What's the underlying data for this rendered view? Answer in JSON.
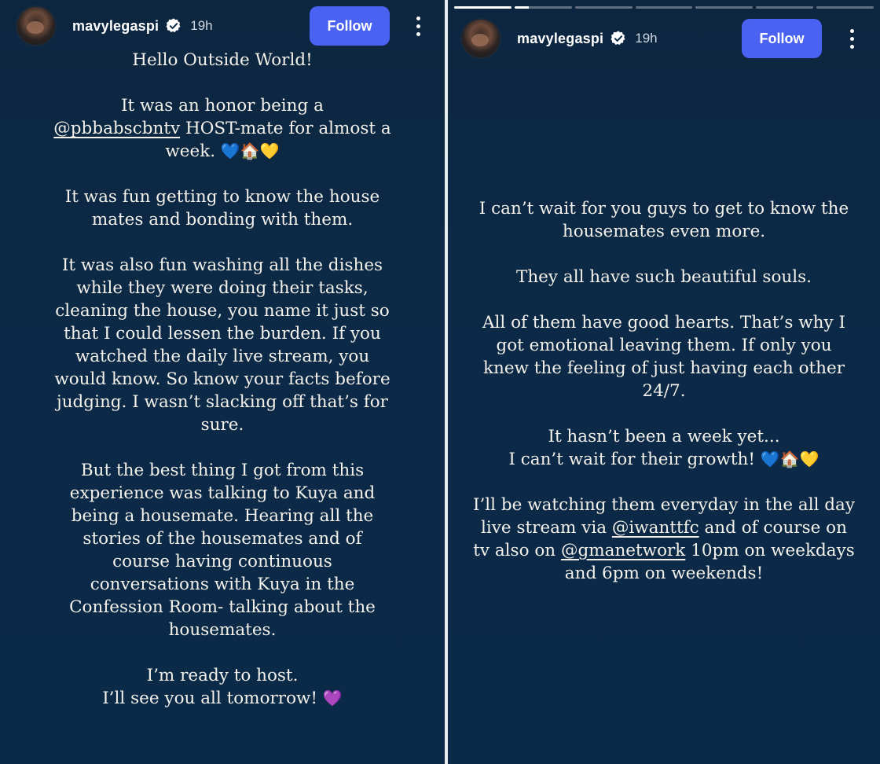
{
  "left_story": {
    "username": "mavylegaspi",
    "time": "19h",
    "follow_label": "Follow",
    "p1": "Hello Outside World!",
    "p2_pre": "It was an honor being a",
    "p2_mention": "@pbbabscbntv",
    "p2_post": " HOST-mate for almost a week.",
    "p2_emoji": "💙🏠💛",
    "p3": "It was fun getting to know the house mates and bonding with them.",
    "p4": "It was also fun washing all the dishes while they were doing their tasks, cleaning the house, you name it just so that I could lessen the burden. If you watched the daily live stream, you would know. So know your facts before judging. I wasn’t slacking off that’s for sure.",
    "p5": "But the best thing I got from this experience was talking to Kuya and being a housemate. Hearing all the stories of the housemates and of course having continuous conversations with Kuya in the Confession Room- talking about the housemates.",
    "p6_line1": "I’m ready to host.",
    "p6_line2": "I’ll see you all tomorrow!",
    "p6_emoji": "💜"
  },
  "right_story": {
    "username": "mavylegaspi",
    "time": "19h",
    "follow_label": "Follow",
    "progress": [
      1,
      0.25,
      0,
      0,
      0,
      0,
      0
    ],
    "p1": "I can’t wait for you guys to get to know the housemates even more.",
    "p2": "They all have such beautiful souls.",
    "p3": "All of them have good hearts. That’s why I got emotional leaving them. If only you knew the feeling of just having each other 24/7.",
    "p4_line1": "It hasn’t been a week yet...",
    "p4_line2": "I can’t wait for their growth!",
    "p4_emoji": "💙🏠💛",
    "p5_pre": "I’ll be watching them everyday in the all day live stream via ",
    "p5_mention1": "@iwanttfc",
    "p5_mid": " and of course on tv also on ",
    "p5_mention2": "@gmanetwork",
    "p5_post": " 10pm on weekdays and 6pm on weekends!"
  },
  "colors": {
    "follow_button": "#4a62f1",
    "story_background": "#0c2a47",
    "text": "#f3f1ea"
  },
  "icons": {
    "verified": "verified-badge-icon",
    "more": "more-vertical-icon"
  }
}
